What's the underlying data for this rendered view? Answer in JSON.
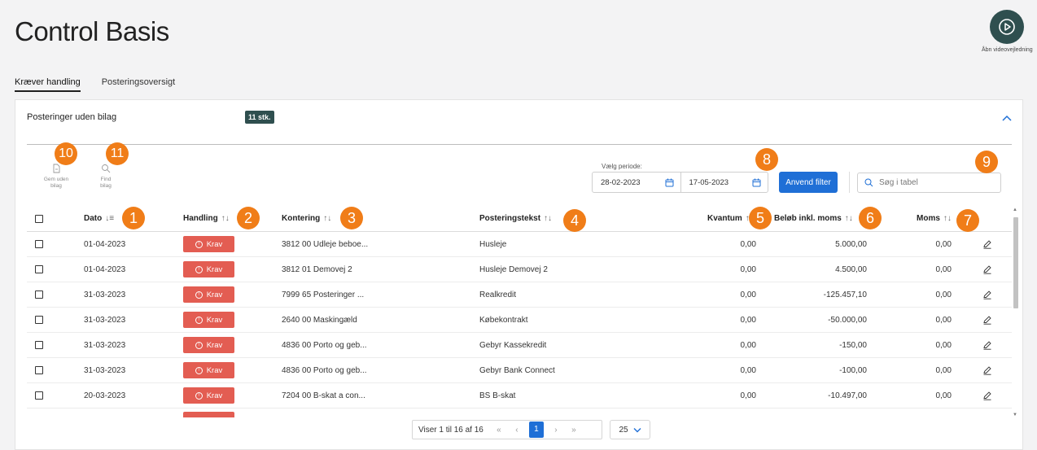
{
  "page_title": "Control Basis",
  "video_button": {
    "label": "Åbn videovejledning",
    "icon": "play-circle-icon"
  },
  "tabs": [
    {
      "label": "Kræver handling",
      "active": true
    },
    {
      "label": "Posteringsoversigt",
      "active": false
    }
  ],
  "card": {
    "title": "Posteringer uden bilag",
    "count_badge": "11 stk.",
    "collapse_icon": "chevron-up-icon"
  },
  "toolbar": {
    "send_label_1": "Gem uden",
    "send_label_2": "bilag",
    "find_label_1": "Find",
    "find_label_2": "bilag",
    "period_label": "Vælg periode:",
    "date_from": "28-02-2023",
    "date_to": "17-05-2023",
    "apply_label": "Anvend filter",
    "search_placeholder": "Søg i tabel"
  },
  "columns": {
    "date": "Dato",
    "action": "Handling",
    "account": "Kontering",
    "text": "Posteringstekst",
    "quantity": "Kvantum",
    "amount": "Beløb inkl. moms",
    "vat": "Moms",
    "sort_icon": "↑↓",
    "date_sort_icon": "↓≡"
  },
  "rows": [
    {
      "date": "01-04-2023",
      "action": "Krav",
      "account": "3812 00 Udleje beboe...",
      "text": "Husleje",
      "quantity": "0,00",
      "amount": "5.000,00",
      "vat": "0,00"
    },
    {
      "date": "01-04-2023",
      "action": "Krav",
      "account": "3812 01 Demovej 2",
      "text": "Husleje Demovej 2",
      "quantity": "0,00",
      "amount": "4.500,00",
      "vat": "0,00"
    },
    {
      "date": "31-03-2023",
      "action": "Krav",
      "account": "7999 65 Posteringer ...",
      "text": "Realkredit",
      "quantity": "0,00",
      "amount": "-125.457,10",
      "vat": "0,00"
    },
    {
      "date": "31-03-2023",
      "action": "Krav",
      "account": "2640 00 Maskingæld",
      "text": "Købekontrakt",
      "quantity": "0,00",
      "amount": "-50.000,00",
      "vat": "0,00"
    },
    {
      "date": "31-03-2023",
      "action": "Krav",
      "account": "4836 00 Porto og geb...",
      "text": "Gebyr Kassekredit",
      "quantity": "0,00",
      "amount": "-150,00",
      "vat": "0,00"
    },
    {
      "date": "31-03-2023",
      "action": "Krav",
      "account": "4836 00 Porto og geb...",
      "text": "Gebyr Bank Connect",
      "quantity": "0,00",
      "amount": "-100,00",
      "vat": "0,00"
    },
    {
      "date": "20-03-2023",
      "action": "Krav",
      "account": "7204 00 B-skat a con...",
      "text": "BS B-skat",
      "quantity": "0,00",
      "amount": "-10.497,00",
      "vat": "0,00"
    }
  ],
  "pagination": {
    "info": "Viser 1 til 16 af 16",
    "first": "«",
    "prev": "‹",
    "current": "1",
    "next": "›",
    "last": "»",
    "page_size": "25"
  },
  "markers": [
    "1",
    "2",
    "3",
    "4",
    "5",
    "6",
    "7",
    "8",
    "9",
    "10",
    "11"
  ],
  "colors": {
    "accent": "#1f6fd6",
    "krav": "#e35d52",
    "marker": "#f07d18",
    "badge": "#2f4f4f"
  }
}
